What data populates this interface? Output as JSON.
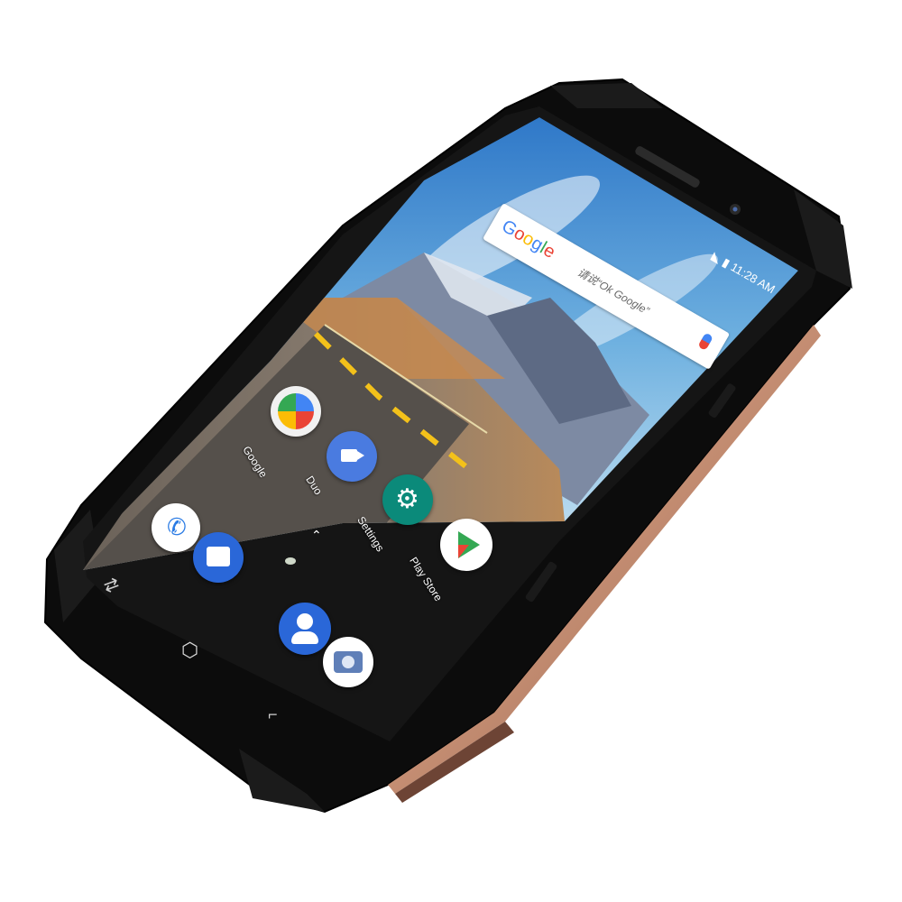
{
  "status_bar": {
    "time": "11:28 AM"
  },
  "search_widget": {
    "logo_text": "Google",
    "hint": "请说“Ok Google”"
  },
  "apps": [
    {
      "label": "Google",
      "icon": "google-folder-icon"
    },
    {
      "label": "Duo",
      "icon": "duo-icon"
    },
    {
      "label": "Settings",
      "icon": "settings-gear-icon"
    },
    {
      "label": "Play Store",
      "icon": "play-store-icon"
    }
  ],
  "dock": [
    {
      "icon": "phone-icon"
    },
    {
      "icon": "messages-icon"
    },
    {
      "icon": "contacts-icon"
    },
    {
      "icon": "camera-icon"
    }
  ],
  "app_drawer": {
    "icon": "chevron-up-icon"
  },
  "nav_bar": {
    "recents_icon": "recents-icon",
    "home_icon": "home-hexagon-icon",
    "back_icon": "back-icon"
  },
  "colors": {
    "google_blue": "#4285F4",
    "google_red": "#EA4335",
    "google_yellow": "#FBBC05",
    "google_green": "#34A853",
    "phone_body": "#111111",
    "rose_gold_frame": "#c9907a"
  }
}
